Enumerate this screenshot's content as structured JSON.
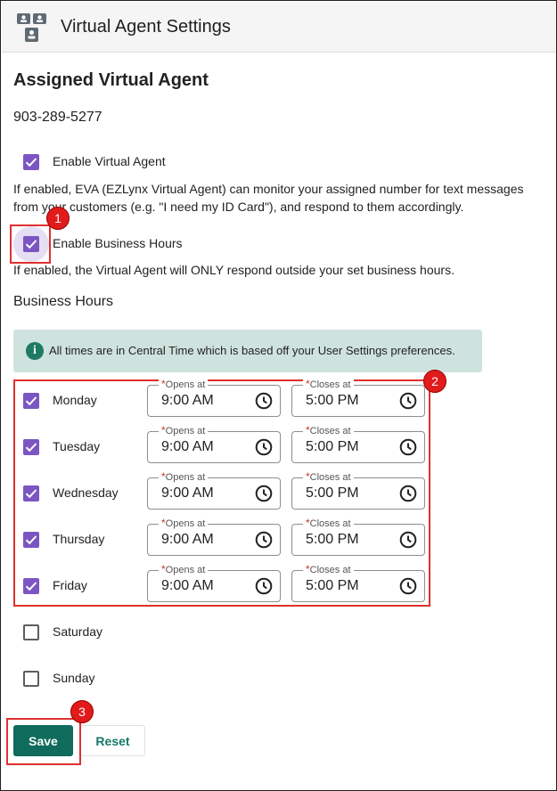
{
  "header": {
    "title": "Virtual Agent Settings",
    "icon": "agent-chat-icon"
  },
  "assigned": {
    "heading": "Assigned Virtual Agent",
    "phone": "903-289-5277"
  },
  "enable_agent": {
    "label": "Enable Virtual Agent",
    "checked": true,
    "description_line1": "If enabled, EVA (EZLynx Virtual Agent) can monitor your assigned number for text messages",
    "description_line2": "from your customers (e.g. \"I need my ID Card\"), and respond to them accordingly."
  },
  "enable_hours": {
    "label": "Enable Business Hours",
    "checked": true,
    "description": "If enabled, the Virtual Agent will ONLY respond outside your set business hours."
  },
  "business_hours": {
    "title": "Business Hours",
    "info": "All times are in Central Time which is based off your User Settings preferences.",
    "opens_label": "Opens at",
    "closes_label": "Closes at",
    "days": [
      {
        "name": "Monday",
        "checked": true,
        "opens": "9:00 AM",
        "closes": "5:00 PM"
      },
      {
        "name": "Tuesday",
        "checked": true,
        "opens": "9:00 AM",
        "closes": "5:00 PM"
      },
      {
        "name": "Wednesday",
        "checked": true,
        "opens": "9:00 AM",
        "closes": "5:00 PM"
      },
      {
        "name": "Thursday",
        "checked": true,
        "opens": "9:00 AM",
        "closes": "5:00 PM"
      },
      {
        "name": "Friday",
        "checked": true,
        "opens": "9:00 AM",
        "closes": "5:00 PM"
      },
      {
        "name": "Saturday",
        "checked": false
      },
      {
        "name": "Sunday",
        "checked": false
      }
    ]
  },
  "actions": {
    "save": "Save",
    "reset": "Reset"
  },
  "annotations": [
    "1",
    "2",
    "3"
  ],
  "colors": {
    "checkbox": "#7b56c2",
    "primary_button": "#0f6b5b",
    "info_banner": "#cfe3de",
    "annotation": "#e11b1b"
  }
}
